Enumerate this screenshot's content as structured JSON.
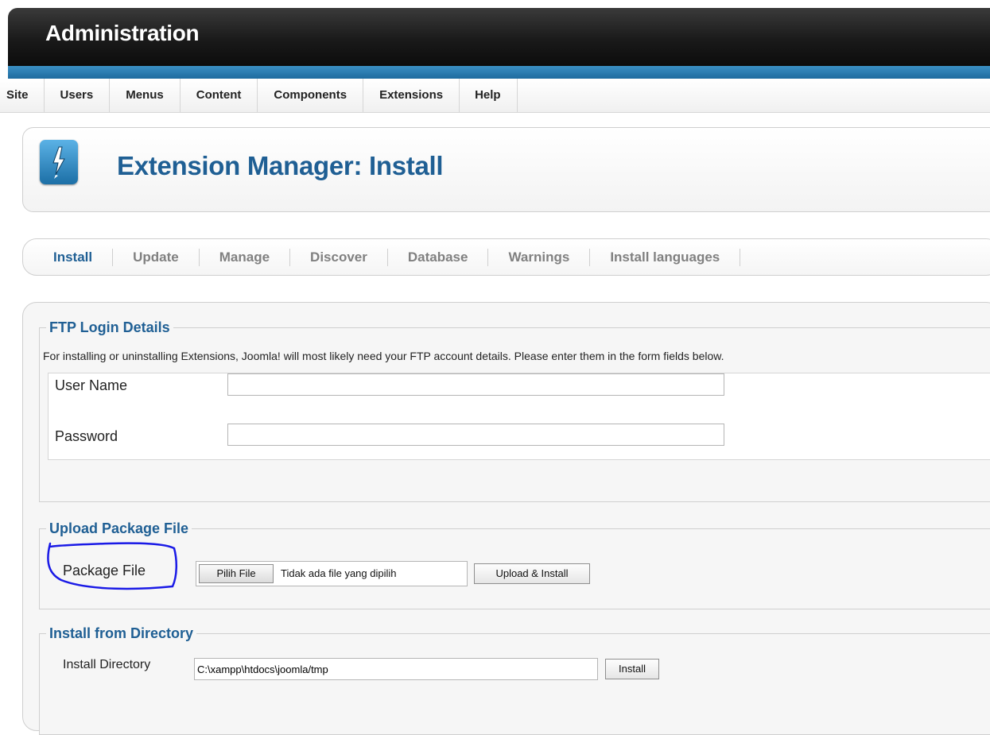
{
  "header": {
    "title": "Administration"
  },
  "menu": [
    "Site",
    "Users",
    "Menus",
    "Content",
    "Components",
    "Extensions",
    "Help"
  ],
  "page": {
    "title": "Extension Manager: Install",
    "icon": "extension-manager-bolt-icon"
  },
  "subnav": [
    "Install",
    "Update",
    "Manage",
    "Discover",
    "Database",
    "Warnings",
    "Install languages"
  ],
  "ftp": {
    "legend": "FTP Login Details",
    "note": "For installing or uninstalling Extensions, Joomla! will most likely need your FTP account details. Please enter them in the form fields below.",
    "username_label": "User Name",
    "username_value": "",
    "password_label": "Password",
    "password_value": ""
  },
  "upload": {
    "legend": "Upload Package File",
    "file_label": "Package File",
    "choose_button": "Pilih File",
    "file_status": "Tidak ada file yang dipilih",
    "submit_button": "Upload & Install"
  },
  "directory": {
    "legend": "Install from Directory",
    "label": "Install Directory",
    "value": "C:\\xampp\\htdocs\\joomla/tmp",
    "submit_button": "Install"
  },
  "colors": {
    "accent": "#1f5f94",
    "header_bar": "#1d6a9e",
    "annotation": "#1a1ae6"
  }
}
